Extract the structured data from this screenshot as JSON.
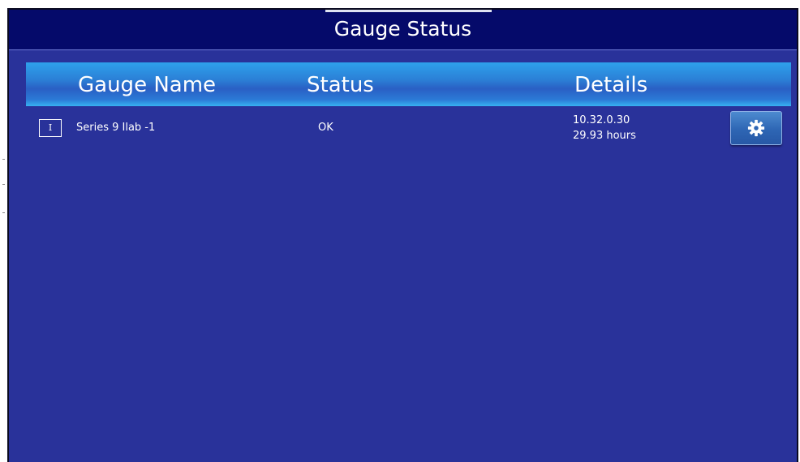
{
  "window": {
    "title": "Gauge Status"
  },
  "table": {
    "columns": [
      "Gauge Name",
      "Status",
      "Details"
    ],
    "rows": [
      {
        "checkbox_label": "I",
        "name": "Series 9 Ilab -1",
        "status": "OK",
        "details_ip": "10.32.0.30",
        "details_hours": "29.93 hours",
        "action_icon": "gear-icon"
      }
    ]
  },
  "colors": {
    "background": "#29329a",
    "titlebar": "#050a6a",
    "header_gradient_top": "#2ea1ec",
    "header_gradient_mid": "#2a5fc4",
    "button": "#2e66b4"
  }
}
